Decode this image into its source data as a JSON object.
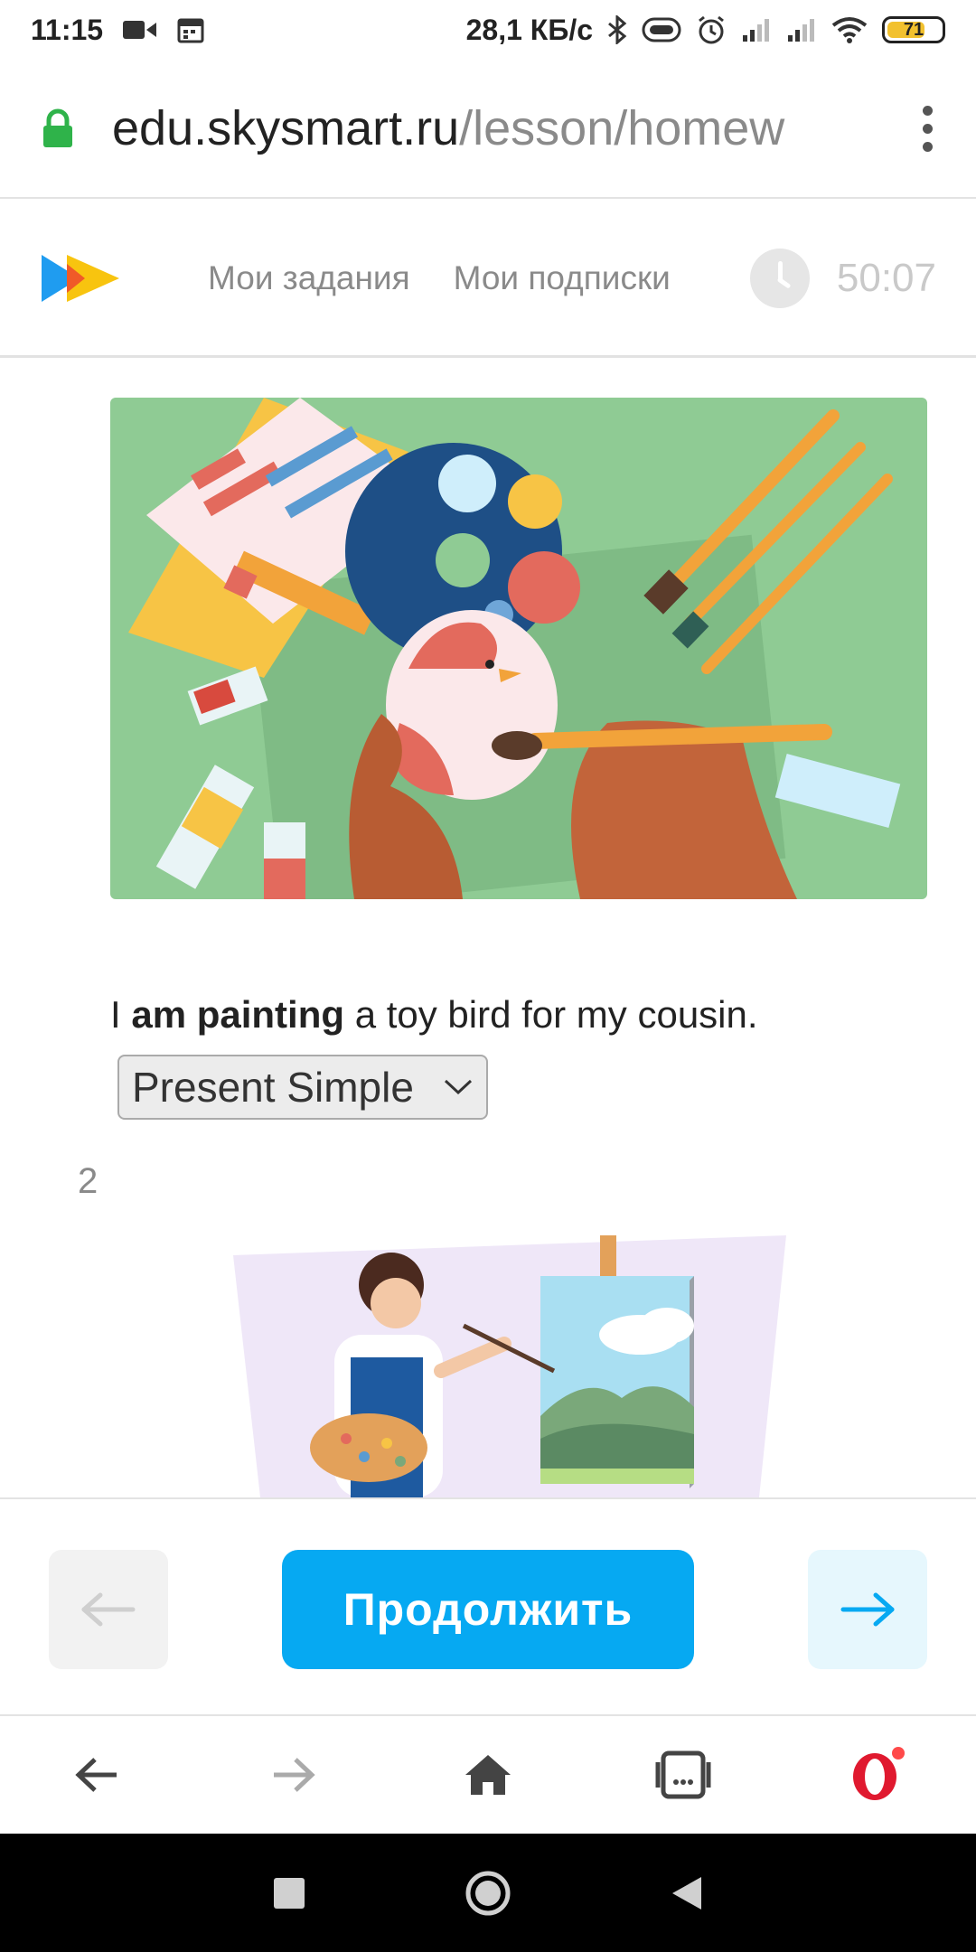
{
  "status_bar": {
    "time": "11:15",
    "speed": "28,1 КБ/с",
    "battery_percent": "71",
    "battery_level": 0.71
  },
  "address_bar": {
    "url_host": "edu.skysmart.ru",
    "url_path": "/lesson/homew"
  },
  "header": {
    "nav": [
      "Мои задания",
      "Мои подписки"
    ],
    "timer": "50:07"
  },
  "task_1": {
    "sentence_start": "I ",
    "sentence_bold": "am painting",
    "sentence_end": " a toy bird for my cousin.",
    "selected_tense": "Present Simple"
  },
  "task_2": {
    "number": "2"
  },
  "actions": {
    "continue_label": "Продолжить"
  },
  "colors": {
    "accent": "#06a9f2",
    "next_bg": "#e6f7fd",
    "prev_bg": "#f2f2f2",
    "lock_green": "#2fb34a"
  }
}
